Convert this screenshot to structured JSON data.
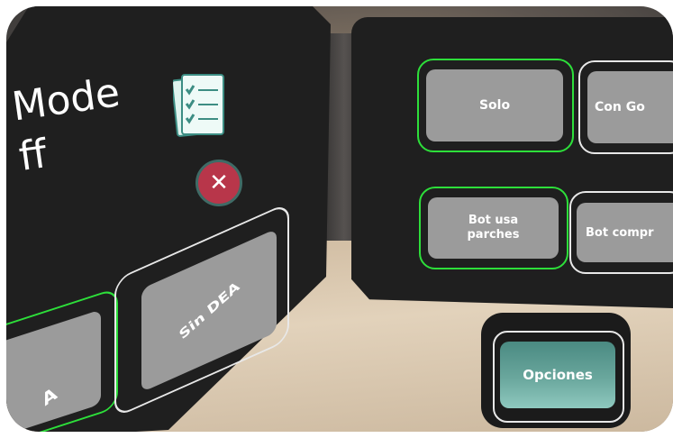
{
  "left_panel": {
    "title_line1": "Mode",
    "title_line2": "ff",
    "btn_selected_label": "A",
    "btn_sin_dea_label": "Sin DEA"
  },
  "right_panel": {
    "solo_label": "Solo",
    "con_label": "Con Go",
    "bot_parches_label": "Bot usa parches",
    "bot_compr_label": "Bot compr"
  },
  "options": {
    "label": "Opciones"
  },
  "icons": {
    "clipboard": "clipboard-checklist-icon",
    "close": "close-icon"
  },
  "colors": {
    "selected_border": "#2ddf3a",
    "button_gray": "#9b9b9b",
    "options_teal": "#5f9f96",
    "close_red": "#b8364a"
  }
}
